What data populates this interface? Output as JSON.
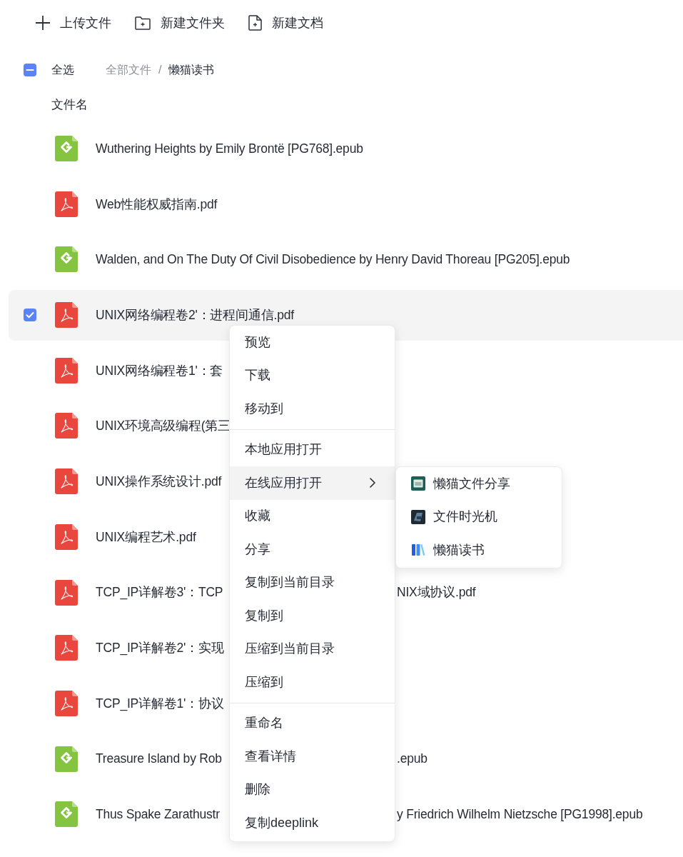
{
  "toolbar": [
    {
      "label": "上传文件"
    },
    {
      "label": "新建文件夹"
    },
    {
      "label": "新建文档"
    }
  ],
  "select_all": {
    "label": "全选",
    "checked": false,
    "indeterminate": true
  },
  "breadcrumb": {
    "separator": "/",
    "items": [
      {
        "label": "全部文件",
        "current": false
      },
      {
        "label": "懒猫读书",
        "current": true
      }
    ]
  },
  "table": {
    "columns": [
      "文件名"
    ],
    "rows": [
      {
        "kind": "epub",
        "name_parts": [
          "Wuthering Heights by Emily Brontë [PG768].epub"
        ],
        "selected": false
      },
      {
        "kind": "pdf",
        "name_parts": [
          "Web性能权威指南.pdf"
        ],
        "selected": false
      },
      {
        "kind": "epub",
        "name_parts": [
          "Walden, and On The Duty Of Civil Disobedience by Henry David Thoreau [PG205].epub"
        ],
        "selected": false
      },
      {
        "kind": "pdf",
        "name_parts": [
          "UNIX网络编程卷2'：进程间通信.pdf"
        ],
        "selected": true
      },
      {
        "kind": "pdf",
        "name_parts": [
          "UNIX网络编程卷1'：套"
        ],
        "selected": false
      },
      {
        "kind": "pdf",
        "name_parts": [
          "UNIX环境高级编程(第三"
        ],
        "selected": false
      },
      {
        "kind": "pdf",
        "name_parts": [
          "UNIX操作系统设计.pdf"
        ],
        "selected": false
      },
      {
        "kind": "pdf",
        "name_parts": [
          "UNIX编程艺术.pdf"
        ],
        "selected": false
      },
      {
        "kind": "pdf",
        "name_parts": [
          "TCP_IP详解卷3'：TCP",
          "NIX域协议.pdf"
        ],
        "selected": false
      },
      {
        "kind": "pdf",
        "name_parts": [
          "TCP_IP详解卷2'：实现"
        ],
        "selected": false
      },
      {
        "kind": "pdf",
        "name_parts": [
          "TCP_IP详解卷1'：协议"
        ],
        "selected": false
      },
      {
        "kind": "epub",
        "name_parts": [
          "Treasure Island by Rob",
          ".epub"
        ],
        "selected": false
      },
      {
        "kind": "epub",
        "name_parts": [
          "Thus Spake Zarathustr",
          "y Friedrich Wilhelm Nietzsche [PG1998].epub"
        ],
        "selected": false
      }
    ]
  },
  "context_menu": {
    "groups": [
      [
        {
          "label": "预览",
          "selected": false,
          "has_submenu": false
        },
        {
          "label": "下载",
          "selected": false,
          "has_submenu": false
        },
        {
          "label": "移动到",
          "selected": false,
          "has_submenu": false
        }
      ],
      [
        {
          "label": "本地应用打开",
          "selected": false,
          "has_submenu": false
        },
        {
          "label": "在线应用打开",
          "selected": true,
          "has_submenu": true
        },
        {
          "label": "收藏",
          "selected": false,
          "has_submenu": false
        },
        {
          "label": "分享",
          "selected": false,
          "has_submenu": false
        },
        {
          "label": "复制到当前目录",
          "selected": false,
          "has_submenu": false
        },
        {
          "label": "复制到",
          "selected": false,
          "has_submenu": false
        },
        {
          "label": "压缩到当前目录",
          "selected": false,
          "has_submenu": false
        },
        {
          "label": "压缩到",
          "selected": false,
          "has_submenu": false
        }
      ],
      [
        {
          "label": "重命名",
          "selected": false,
          "has_submenu": false
        },
        {
          "label": "查看详情",
          "selected": false,
          "has_submenu": false
        },
        {
          "label": "删除",
          "selected": false,
          "has_submenu": false
        },
        {
          "label": "复制deeplink",
          "selected": false,
          "has_submenu": false
        }
      ]
    ]
  },
  "submenu": {
    "items": [
      {
        "label": "懒猫文件分享",
        "selected": false
      },
      {
        "label": "文件时光机",
        "selected": false
      },
      {
        "label": "懒猫读书",
        "selected": false
      }
    ]
  }
}
